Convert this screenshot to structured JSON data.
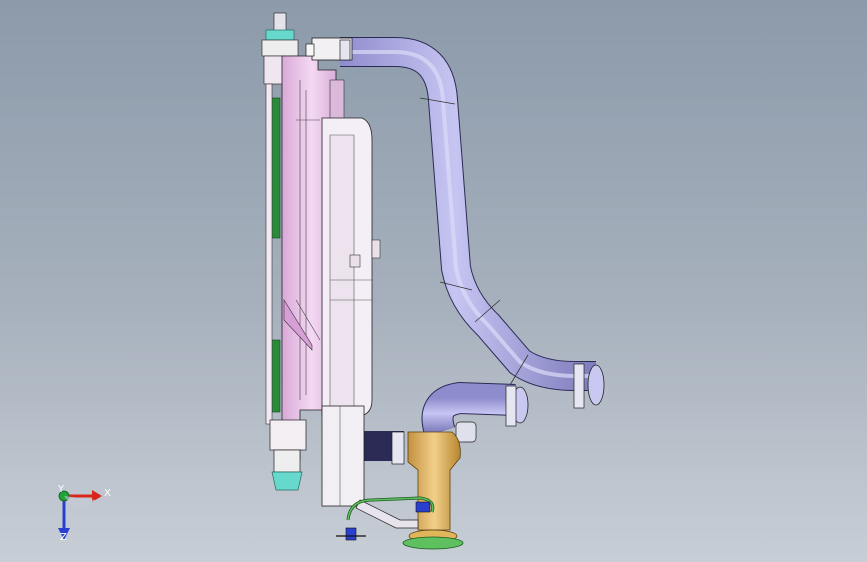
{
  "triad": {
    "x_label": "X",
    "y_label": "Y",
    "z_label": "Z",
    "x_color": "#d8261c",
    "y_color": "#22a33a",
    "z_color": "#2a3fd0"
  },
  "colors": {
    "background_top": "#8c9aaa",
    "background_bottom": "#c8ced6",
    "radiator_pink": "#e8c4e6",
    "hose_lavender": "#b3b2e6",
    "fitting_gold": "#e1b55a",
    "seal_green": "#2a8a3a",
    "cap_cyan": "#66d8cc"
  }
}
